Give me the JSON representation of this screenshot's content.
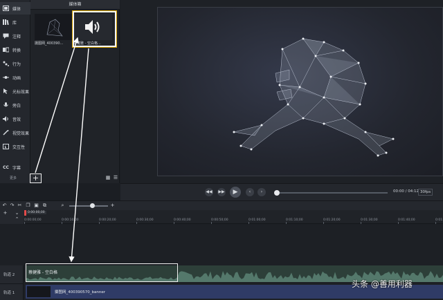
{
  "sidebar": {
    "items": [
      {
        "label": "媒体",
        "icon": "media-icon"
      },
      {
        "label": "库",
        "icon": "library-icon"
      },
      {
        "label": "注释",
        "icon": "annotation-icon"
      },
      {
        "label": "转换",
        "icon": "transition-icon"
      },
      {
        "label": "行为",
        "icon": "behavior-icon"
      },
      {
        "label": "动画",
        "icon": "animation-icon"
      },
      {
        "label": "光标效果",
        "icon": "cursor-effect-icon"
      },
      {
        "label": "旁白",
        "icon": "narration-icon"
      },
      {
        "label": "音效",
        "icon": "audio-effect-icon"
      },
      {
        "label": "视觉效果",
        "icon": "visual-effect-icon"
      },
      {
        "label": "交互性",
        "icon": "interactivity-icon"
      },
      {
        "label": "字幕",
        "icon": "captions-icon"
      }
    ],
    "more_label": "更多",
    "add_label": "+"
  },
  "media_bin": {
    "title": "媒体箱",
    "items": [
      {
        "caption": "摄图网_400390...",
        "kind": "video"
      },
      {
        "caption": "蔡健雅 - 空白格...",
        "kind": "audio",
        "icon": "speaker-icon"
      }
    ]
  },
  "player": {
    "time": "00:00 / 04:12",
    "fps": "30fps"
  },
  "timeline": {
    "playhead_time": "0:00:00;00",
    "ruler_ticks": [
      "0:00:00;00",
      "0:00:10;00",
      "0:00:20;00",
      "0:00:30;00",
      "0:00:40;00",
      "0:00:50;00",
      "0:01:00;00",
      "0:01:10;00",
      "0:01:20;00",
      "0:01:30;00",
      "0:01:40;00",
      "0:01:50;00"
    ],
    "tracks": [
      {
        "label": "轨道 2",
        "clip": "蔡健雅 - 空白格"
      },
      {
        "label": "轨道 1",
        "clip": "摄图网_400390570_banner"
      }
    ]
  },
  "watermark": "头条 @善用利器",
  "colors": {
    "background": "#1b1e23",
    "panel": "#24272d",
    "audio_clip": "#2d3f39",
    "video_clip": "#2f3b66",
    "highlight": "#d9a400"
  }
}
